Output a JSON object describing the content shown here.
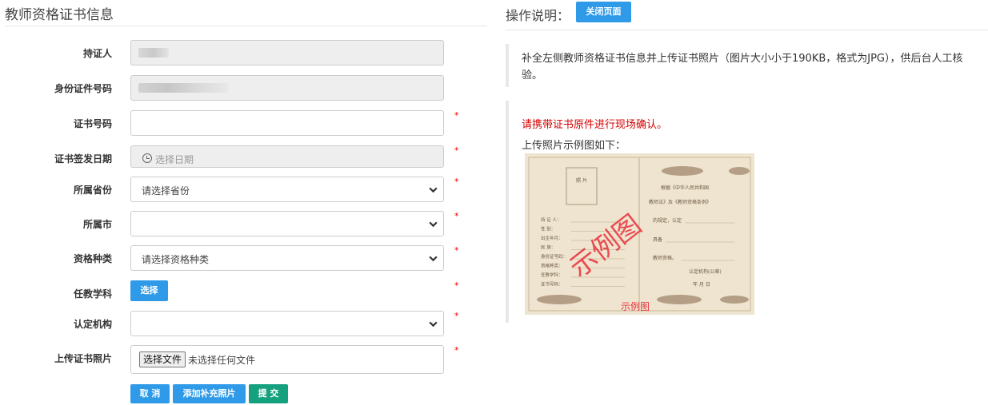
{
  "left_panel": {
    "title": "教师资格证书信息",
    "fields": {
      "holder": {
        "label": "持证人"
      },
      "id_number": {
        "label": "身份证件号码"
      },
      "cert_number": {
        "label": "证书号码",
        "value": ""
      },
      "issue_date": {
        "label": "证书签发日期",
        "placeholder": "选择日期"
      },
      "province": {
        "label": "所属省份",
        "selected": "请选择省份"
      },
      "city": {
        "label": "所属市",
        "selected": ""
      },
      "qualification": {
        "label": "资格种类",
        "selected": "请选择资格种类"
      },
      "subject": {
        "label": "任教学科",
        "button": "选择"
      },
      "authority": {
        "label": "认定机构",
        "selected": ""
      },
      "photo": {
        "label": "上传证书照片",
        "file_button": "选择文件",
        "file_status": "未选择任何文件"
      }
    },
    "required_mark": "*",
    "actions": {
      "cancel": "取 消",
      "add_photo": "添加补充照片",
      "submit": "提 交"
    }
  },
  "right_panel": {
    "title": "操作说明：",
    "close_button": "关闭页面",
    "instruction": "补全左侧教师资格证书信息并上传证书照片（图片大小小于190KB，格式为JPG），供后台人工核验。",
    "warning": "请携带证书原件进行现场确认。",
    "sample_caption": "上传照片示例图如下：",
    "sample_image": {
      "watermark_big": "示例图",
      "watermark_small": "示例图",
      "photo_box": "照 片",
      "header_text": "根据《中华人民共和国",
      "law_text": "教师法》及《教师资格条例》",
      "rule_text": "的规定，认定",
      "has_text": "具备",
      "qual_text": "教师资格。",
      "authority_text": "认定机构(公章)",
      "date_text": "年    月    日",
      "left_lines": [
        "持 证 人：",
        "性    别：",
        "出生年月：",
        "民    族：",
        "身份证号码：",
        "资格种类：",
        "任教学科：",
        "证书号码："
      ]
    }
  },
  "colors": {
    "primary": "#2f9ae8",
    "success": "#15a07e",
    "required": "#e00000",
    "warning": "#d40000"
  }
}
